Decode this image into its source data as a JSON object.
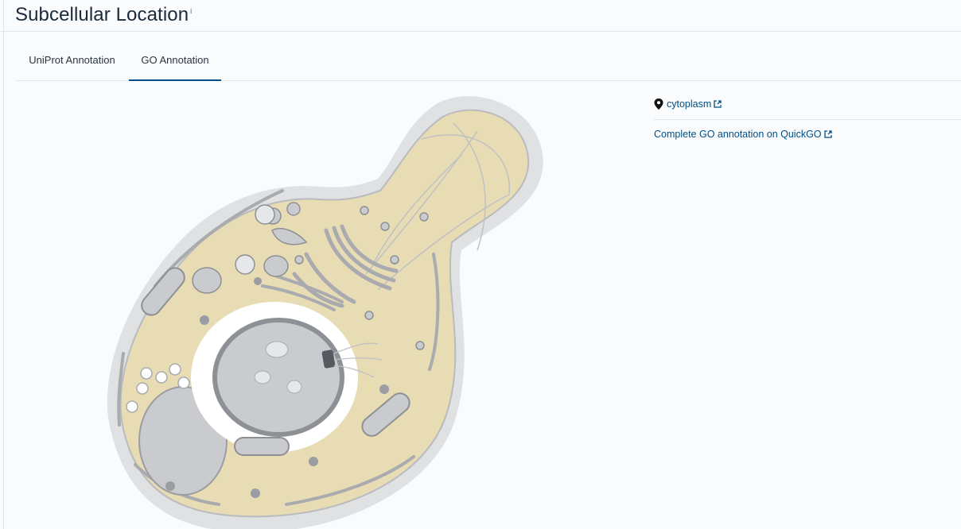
{
  "header": {
    "title": "Subcellular Location",
    "info_glyph": "i"
  },
  "tabs": [
    {
      "label": "UniProt Annotation",
      "active": false
    },
    {
      "label": "GO Annotation",
      "active": true
    }
  ],
  "locations": [
    {
      "label": "cytoplasm",
      "icon": "map-pin-icon",
      "link_icon": "external-link-icon"
    }
  ],
  "quickgo_link": {
    "label": "Complete GO annotation on QuickGO",
    "link_icon": "external-link-icon"
  },
  "colors": {
    "link": "#014f86",
    "cytoplasm_fill": "#e8dcb5",
    "cell_wall": "#d7d9dc",
    "organelle_gray": "#c9cbce",
    "tab_indicator": "#014f86"
  }
}
